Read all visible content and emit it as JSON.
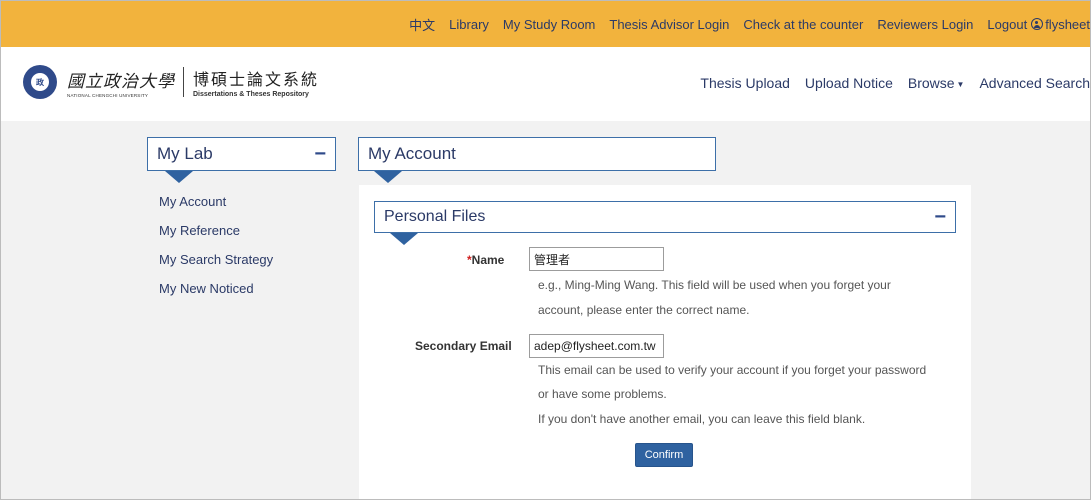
{
  "topbar": {
    "links": [
      "中文",
      "Library",
      "My Study Room",
      "Thesis Advisor Login",
      "Check at the counter",
      "Reviewers Login",
      "Logout"
    ],
    "username": "flysheet"
  },
  "header": {
    "university_cn": "國立政治大學",
    "university_en": "NATIONAL CHENGCHI UNIVERSITY",
    "repo_cn": "博碩士論文系統",
    "repo_en": "Dissertations & Theses Repository",
    "nav": {
      "upload": "Thesis Upload",
      "notice": "Upload Notice",
      "browse": "Browse",
      "advanced": "Advanced Search"
    }
  },
  "sidebar": {
    "title": "My Lab",
    "collapse": "−",
    "items": [
      "My Account",
      "My Reference",
      "My Search Strategy",
      "My New Noticed"
    ]
  },
  "main": {
    "title": "My Account",
    "section_title": "Personal Files",
    "collapse": "−",
    "name_label": "Name",
    "required_mark": "*",
    "name_value": "管理者",
    "name_help_1": "e.g., Ming-Ming Wang. This field will be used when you forget your",
    "name_help_2": "account, please enter the correct name.",
    "email_label": "Secondary Email",
    "email_value": "adep@flysheet.com.tw",
    "email_help_1": "This email can be used to verify your account if you forget your password",
    "email_help_2": "or have some problems.",
    "email_help_3": "If you don't have another email, you can leave this field blank.",
    "confirm_label": "Confirm"
  },
  "colors": {
    "topbar": "#f2b33d",
    "accent": "#2f62a0",
    "text": "#2b3a67"
  }
}
